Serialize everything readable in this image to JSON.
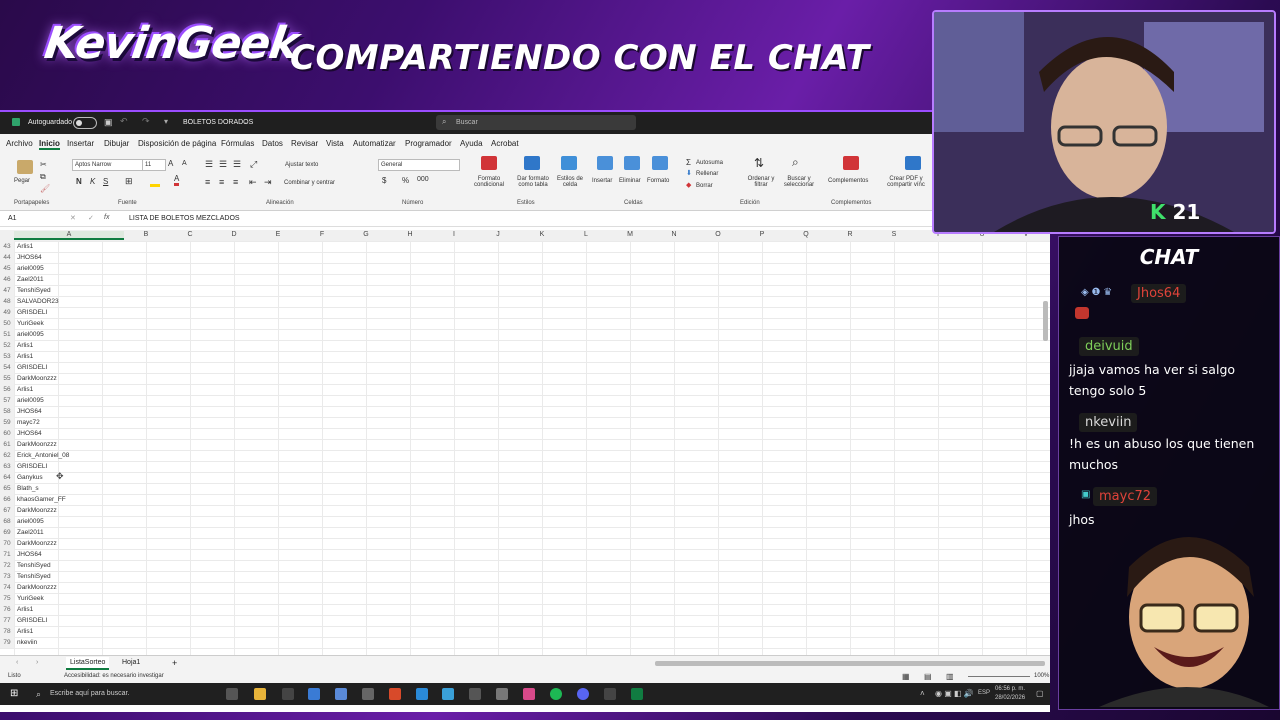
{
  "stream": {
    "logo_text": "KevinGeek",
    "banner_text": "COMPARTIENDO CON EL CHAT",
    "viewer_badge": "K",
    "viewer_count": "21"
  },
  "excel": {
    "autosave_label": "Autoguardado",
    "file_name": "BOLETOS DORADOS",
    "search_placeholder": "Buscar",
    "menu": [
      "Archivo",
      "Inicio",
      "Insertar",
      "Dibujar",
      "Disposición de página",
      "Fórmulas",
      "Datos",
      "Revisar",
      "Vista",
      "Automatizar",
      "Programador",
      "Ayuda",
      "Acrobat"
    ],
    "ribbon": {
      "paste": "Pegar",
      "font_name": "Aptos Narrow",
      "font_size": "11",
      "wrap_text": "Ajustar texto",
      "merge_center": "Combinar y centrar",
      "number_format": "General",
      "conditional_format": "Formato condicional",
      "format_table": "Dar formato como tabla",
      "cell_styles": "Estilos de celda",
      "insert": "Insertar",
      "delete": "Eliminar",
      "format": "Formato",
      "autosum": "Autosuma",
      "fill": "Rellenar",
      "clear": "Borrar",
      "sort_filter": "Ordenar y filtrar",
      "find_select": "Buscar y seleccionar",
      "addins": "Complementos",
      "create_pdf": "Crear PDF y compartir vínc",
      "groups": [
        "Portapapeles",
        "Fuente",
        "Alineación",
        "Número",
        "Estilos",
        "Celdas",
        "Edición",
        "Complementos"
      ]
    },
    "name_box": "A1",
    "formula_content": "LISTA DE BOLETOS MEZCLADOS",
    "columns": [
      "A",
      "B",
      "C",
      "D",
      "E",
      "F",
      "G",
      "H",
      "I",
      "J",
      "K",
      "L",
      "M",
      "N",
      "O",
      "P",
      "Q",
      "R",
      "S",
      "T",
      "U",
      "V"
    ],
    "rows": [
      {
        "n": "43",
        "v": "Arlis1"
      },
      {
        "n": "44",
        "v": "JHOS64"
      },
      {
        "n": "45",
        "v": "ariel0095"
      },
      {
        "n": "46",
        "v": "Zael2011"
      },
      {
        "n": "47",
        "v": "TenshiSyed"
      },
      {
        "n": "48",
        "v": "SALVADOR23"
      },
      {
        "n": "49",
        "v": "GRISDELI"
      },
      {
        "n": "50",
        "v": "YuriGeek"
      },
      {
        "n": "51",
        "v": "ariel0095"
      },
      {
        "n": "52",
        "v": "Arlis1"
      },
      {
        "n": "53",
        "v": "Arlis1"
      },
      {
        "n": "54",
        "v": "GRISDELI"
      },
      {
        "n": "55",
        "v": "DarkMoonzzz"
      },
      {
        "n": "56",
        "v": "Arlis1"
      },
      {
        "n": "57",
        "v": "ariel0095"
      },
      {
        "n": "58",
        "v": "JHOS64"
      },
      {
        "n": "59",
        "v": "mayc72"
      },
      {
        "n": "60",
        "v": "JHOS64"
      },
      {
        "n": "61",
        "v": "DarkMoonzzz"
      },
      {
        "n": "62",
        "v": "Erick_Antoniel_08"
      },
      {
        "n": "63",
        "v": "GRISDELI"
      },
      {
        "n": "64",
        "v": "Ganykus"
      },
      {
        "n": "65",
        "v": "Blath_s"
      },
      {
        "n": "66",
        "v": "khaosGamer_FF"
      },
      {
        "n": "67",
        "v": "DarkMoonzzz"
      },
      {
        "n": "68",
        "v": "ariel0095"
      },
      {
        "n": "69",
        "v": "Zael2011"
      },
      {
        "n": "70",
        "v": "DarkMoonzzz"
      },
      {
        "n": "71",
        "v": "JHOS64"
      },
      {
        "n": "72",
        "v": "TenshiSyed"
      },
      {
        "n": "73",
        "v": "TenshiSyed"
      },
      {
        "n": "74",
        "v": "DarkMoonzzz"
      },
      {
        "n": "75",
        "v": "YuriGeek"
      },
      {
        "n": "76",
        "v": "Arlis1"
      },
      {
        "n": "77",
        "v": "GRISDELI"
      },
      {
        "n": "78",
        "v": "Arlis1"
      },
      {
        "n": "79",
        "v": "nkeviin"
      }
    ],
    "sheets": [
      "ListaSorteo",
      "Hoja1"
    ],
    "status_ready": "Listo",
    "status_accessibility": "Accesibilidad: es necesario investigar",
    "zoom": "100%",
    "taskbar_search": "Escribe aquí para buscar.",
    "taskbar_lang": "ESP",
    "taskbar_time": "06:56 p. m.",
    "taskbar_date": "28/02/2026"
  },
  "chat": {
    "title": "CHAT",
    "messages": [
      {
        "user": "Jhos64",
        "color": "#e0433a",
        "text": ""
      },
      {
        "user": "deivuid",
        "color": "#7ecf5a",
        "text": "jjaja vamos ha ver si salgo tengo solo 5"
      },
      {
        "user": "nkeviin",
        "color": "#d9d9d9",
        "text": "!h es un abuso los que tienen muchos"
      },
      {
        "user": "mayc72",
        "color": "#e0433a",
        "text": "jhos"
      }
    ]
  }
}
